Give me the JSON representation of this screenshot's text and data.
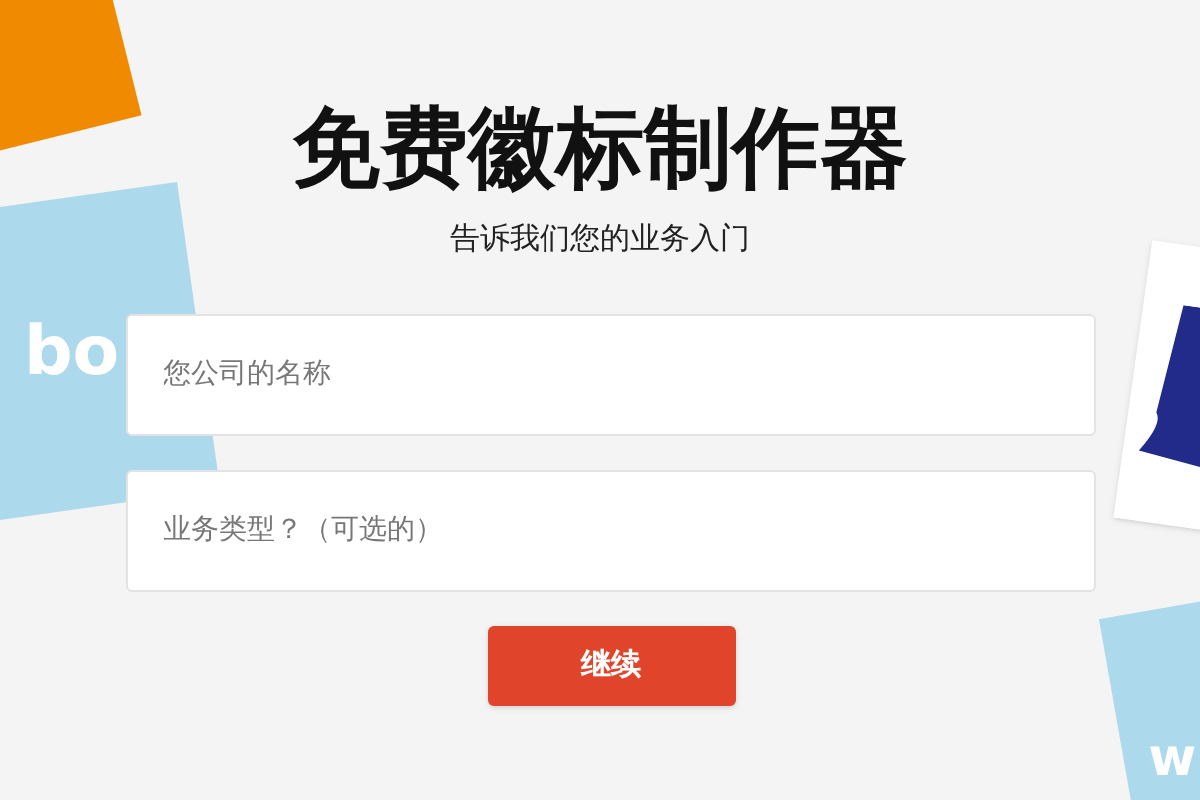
{
  "decor_cards": [
    {
      "kind": "orange"
    },
    {
      "kind": "sky",
      "text": "bo"
    },
    {
      "kind": "navy"
    },
    {
      "kind": "sky-bottom",
      "text": "w"
    }
  ],
  "title": "免费徽标制作器",
  "subtitle": "告诉我们您的业务入门",
  "fields": [
    {
      "placeholder": "您公司的名称"
    },
    {
      "placeholder": "业务类型？（可选的）"
    }
  ],
  "button": "继续"
}
